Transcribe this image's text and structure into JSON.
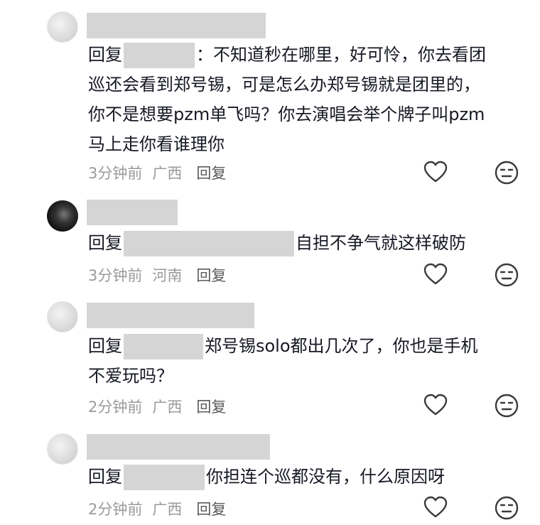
{
  "comments": [
    {
      "reply_prefix": "回复",
      "text_lines": [
        "：不知道秒在哪里，好可怜，你去看团",
        "巡还会看到郑号锡，可是怎么办郑号锡就是团里的，",
        "你不是想要pzm单飞吗？你去演唱会举个牌子叫pzm",
        "马上走你看谁理你"
      ],
      "time": "3分钟前",
      "location": "广西",
      "reply_label": "回复",
      "avatar": "light"
    },
    {
      "reply_prefix": "回复",
      "text_lines": [
        "自担不争气就这样破防"
      ],
      "time": "3分钟前",
      "location": "河南",
      "reply_label": "回复",
      "avatar": "dark"
    },
    {
      "reply_prefix": "回复",
      "text_lines": [
        "郑号锡solo都出几次了，你也是手机",
        "不爱玩吗？"
      ],
      "time": "2分钟前",
      "location": "广西",
      "reply_label": "回复",
      "avatar": "light"
    },
    {
      "reply_prefix": "回复",
      "text_lines": [
        "你担连个巡都没有，什么原因呀"
      ],
      "time": "2分钟前",
      "location": "广西",
      "reply_label": "回复",
      "avatar": "light"
    }
  ],
  "icons": {
    "like": "heart-outline-icon",
    "dislike": "neutral-face-icon"
  },
  "colors": {
    "text": "#161823",
    "meta": "#9a9a9a",
    "redaction": "#d5d5d5"
  }
}
